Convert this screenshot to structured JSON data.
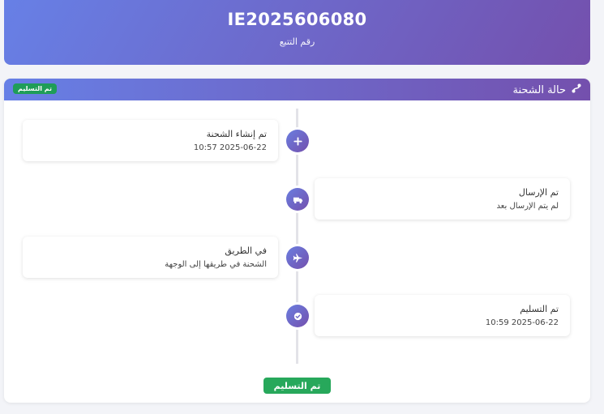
{
  "header": {
    "tracking_number": "IE2025606080",
    "tracking_label": "رقم التتبع"
  },
  "status_card": {
    "title": "حالة الشحنة",
    "title_icon": "route-icon",
    "badge": "تم التسليم",
    "footer_badge": "تم التسليم"
  },
  "timeline": [
    {
      "icon": "plus-icon",
      "title": "تم إنشاء الشحنة",
      "subtitle": "2025-06-22 10:57"
    },
    {
      "icon": "truck-icon",
      "title": "تم الإرسال",
      "subtitle": "لم يتم الإرسال بعد"
    },
    {
      "icon": "plane-icon",
      "title": "في الطريق",
      "subtitle": "الشحنة في طريقها إلى الوجهة"
    },
    {
      "icon": "check-circle-icon",
      "title": "تم التسليم",
      "subtitle": "2025-06-22 10:59"
    }
  ],
  "colors": {
    "gradient_start": "#6780e6",
    "gradient_end": "#7450ad",
    "success": "#27a85b"
  }
}
